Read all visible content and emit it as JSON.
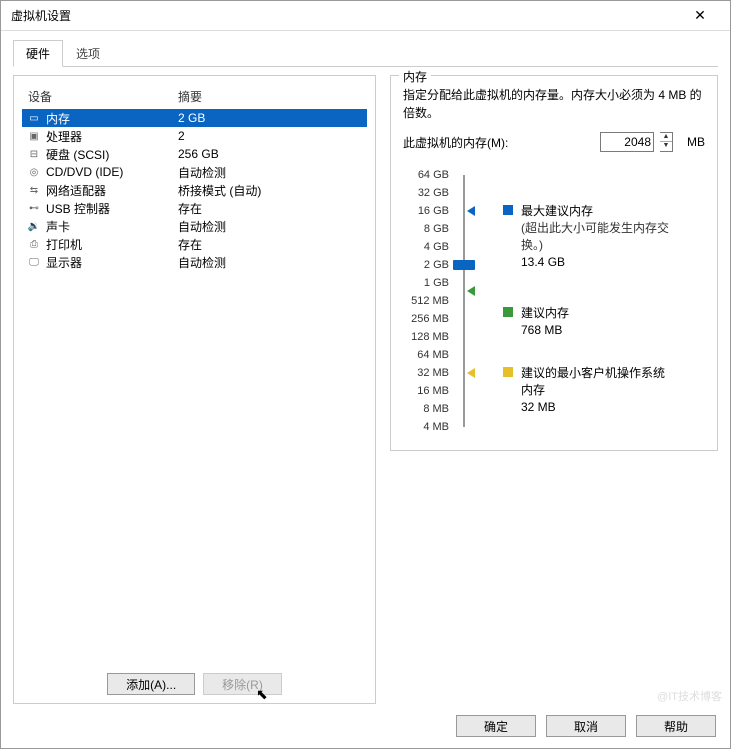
{
  "window": {
    "title": "虚拟机设置"
  },
  "tabs": {
    "hardware": "硬件",
    "options": "选项"
  },
  "columns": {
    "device": "设备",
    "summary": "摘要"
  },
  "devices": [
    {
      "icon": "memory-icon",
      "glyph": "▭",
      "name": "内存",
      "summary": "2 GB",
      "selected": true
    },
    {
      "icon": "cpu-icon",
      "glyph": "▣",
      "name": "处理器",
      "summary": "2"
    },
    {
      "icon": "disk-icon",
      "glyph": "⊟",
      "name": "硬盘 (SCSI)",
      "summary": "256 GB"
    },
    {
      "icon": "cd-icon",
      "glyph": "◎",
      "name": "CD/DVD (IDE)",
      "summary": "自动检测"
    },
    {
      "icon": "network-icon",
      "glyph": "⇆",
      "name": "网络适配器",
      "summary": "桥接模式 (自动)"
    },
    {
      "icon": "usb-icon",
      "glyph": "⊷",
      "name": "USB 控制器",
      "summary": "存在"
    },
    {
      "icon": "sound-icon",
      "glyph": "🔉",
      "name": "声卡",
      "summary": "自动检测"
    },
    {
      "icon": "printer-icon",
      "glyph": "⎙",
      "name": "打印机",
      "summary": "存在"
    },
    {
      "icon": "display-icon",
      "glyph": "🖵",
      "name": "显示器",
      "summary": "自动检测"
    }
  ],
  "buttons": {
    "add": "添加(A)...",
    "remove": "移除(R)",
    "ok": "确定",
    "cancel": "取消",
    "help": "帮助"
  },
  "memory": {
    "group_title": "内存",
    "description": "指定分配给此虚拟机的内存量。内存大小必须为 4 MB 的倍数。",
    "label": "此虚拟机的内存(M):",
    "value": "2048",
    "unit": "MB",
    "ticks": [
      "64 GB",
      "32 GB",
      "16 GB",
      "8 GB",
      "4 GB",
      "2 GB",
      "1 GB",
      "512 MB",
      "256 MB",
      "128 MB",
      "64 MB",
      "32 MB",
      "16 MB",
      "8 MB",
      "4 MB"
    ],
    "legend": {
      "max": {
        "line1": "最大建议内存",
        "line2": "(超出此大小可能发生内存交换。)",
        "value": "13.4 GB"
      },
      "rec": {
        "line1": "建议内存",
        "value": "768 MB"
      },
      "min": {
        "line1": "建议的最小客户机操作系统内存",
        "value": "32 MB"
      }
    }
  },
  "watermark": "@IT技术博客"
}
